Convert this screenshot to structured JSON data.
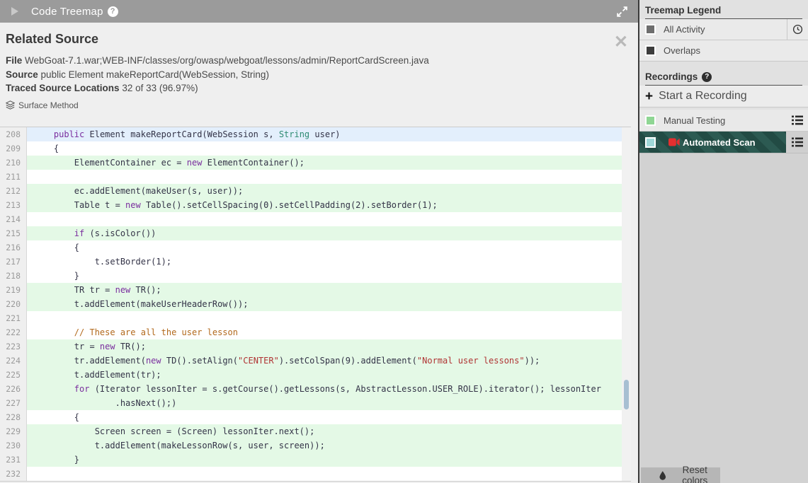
{
  "header": {
    "title": "Code Treemap"
  },
  "related_source": {
    "title": "Related Source",
    "file_label": "File",
    "file_value": "WebGoat-7.1.war;WEB-INF/classes/org/owasp/webgoat/lessons/admin/ReportCardScreen.java",
    "source_label": "Source",
    "source_value": "public Element makeReportCard(WebSession, String)",
    "traced_label": "Traced Source Locations",
    "traced_value": "32 of 33 (96.97%)",
    "method_type": "Surface Method"
  },
  "code": {
    "highlight_green": "#e4f9e6",
    "highlight_blue": "#e3effc",
    "lines": [
      {
        "num": 208,
        "hl": "blue",
        "seg": [
          [
            "p",
            "    "
          ],
          [
            "k",
            "public"
          ],
          [
            "p",
            " Element makeReportCard(WebSession s, "
          ],
          [
            "t",
            "String"
          ],
          [
            "p",
            " user)"
          ]
        ]
      },
      {
        "num": 209,
        "hl": "",
        "seg": [
          [
            "p",
            "    {"
          ]
        ]
      },
      {
        "num": 210,
        "hl": "green",
        "seg": [
          [
            "p",
            "        ElementContainer ec = "
          ],
          [
            "k",
            "new"
          ],
          [
            "p",
            " ElementContainer();"
          ]
        ]
      },
      {
        "num": 211,
        "hl": "",
        "seg": []
      },
      {
        "num": 212,
        "hl": "green",
        "seg": [
          [
            "p",
            "        ec.addElement(makeUser(s, user));"
          ]
        ]
      },
      {
        "num": 213,
        "hl": "green",
        "seg": [
          [
            "p",
            "        Table t = "
          ],
          [
            "k",
            "new"
          ],
          [
            "p",
            " Table().setCellSpacing(0).setCellPadding(2).setBorder(1);"
          ]
        ]
      },
      {
        "num": 214,
        "hl": "",
        "seg": []
      },
      {
        "num": 215,
        "hl": "green",
        "seg": [
          [
            "p",
            "        "
          ],
          [
            "k",
            "if"
          ],
          [
            "p",
            " (s.isColor())"
          ]
        ]
      },
      {
        "num": 216,
        "hl": "",
        "seg": [
          [
            "p",
            "        {"
          ]
        ]
      },
      {
        "num": 217,
        "hl": "",
        "seg": [
          [
            "p",
            "            t.setBorder(1);"
          ]
        ]
      },
      {
        "num": 218,
        "hl": "",
        "seg": [
          [
            "p",
            "        }"
          ]
        ]
      },
      {
        "num": 219,
        "hl": "green",
        "seg": [
          [
            "p",
            "        TR tr = "
          ],
          [
            "k",
            "new"
          ],
          [
            "p",
            " TR();"
          ]
        ]
      },
      {
        "num": 220,
        "hl": "green",
        "seg": [
          [
            "p",
            "        t.addElement(makeUserHeaderRow());"
          ]
        ]
      },
      {
        "num": 221,
        "hl": "",
        "seg": []
      },
      {
        "num": 222,
        "hl": "",
        "seg": [
          [
            "c",
            "        // These are all the user lesson"
          ]
        ]
      },
      {
        "num": 223,
        "hl": "green",
        "seg": [
          [
            "p",
            "        tr = "
          ],
          [
            "k",
            "new"
          ],
          [
            "p",
            " TR();"
          ]
        ]
      },
      {
        "num": 224,
        "hl": "green",
        "seg": [
          [
            "p",
            "        tr.addElement("
          ],
          [
            "k",
            "new"
          ],
          [
            "p",
            " TD().setAlign("
          ],
          [
            "s",
            "\"CENTER\""
          ],
          [
            "p",
            ").setColSpan(9).addElement("
          ],
          [
            "s",
            "\"Normal user lessons\""
          ],
          [
            "p",
            "));"
          ]
        ]
      },
      {
        "num": 225,
        "hl": "green",
        "seg": [
          [
            "p",
            "        t.addElement(tr);"
          ]
        ]
      },
      {
        "num": 226,
        "hl": "green",
        "seg": [
          [
            "p",
            "        "
          ],
          [
            "k",
            "for"
          ],
          [
            "p",
            " (Iterator lessonIter = s.getCourse().getLessons(s, AbstractLesson.USER_ROLE).iterator(); lessonIter"
          ]
        ]
      },
      {
        "num": 227,
        "hl": "green",
        "seg": [
          [
            "p",
            "                .hasNext();)"
          ]
        ]
      },
      {
        "num": 228,
        "hl": "",
        "seg": [
          [
            "p",
            "        {"
          ]
        ]
      },
      {
        "num": 229,
        "hl": "green",
        "seg": [
          [
            "p",
            "            Screen screen = (Screen) lessonIter.next();"
          ]
        ]
      },
      {
        "num": 230,
        "hl": "green",
        "seg": [
          [
            "p",
            "            t.addElement(makeLessonRow(s, user, screen));"
          ]
        ]
      },
      {
        "num": 231,
        "hl": "green",
        "seg": [
          [
            "p",
            "        }"
          ]
        ]
      },
      {
        "num": 232,
        "hl": "",
        "seg": []
      }
    ]
  },
  "sidebar": {
    "legend": {
      "title": "Treemap Legend",
      "items": [
        {
          "label": "All Activity",
          "swatch": "#6e6e6e",
          "time_icon": true
        },
        {
          "label": "Overlaps",
          "swatch": "#3c3c3c",
          "time_icon": false
        }
      ]
    },
    "recordings": {
      "title": "Recordings",
      "start_label": "Start a Recording",
      "items": [
        {
          "label": "Manual Testing",
          "swatch": "#8fd694",
          "active": false
        },
        {
          "label": "Automated Scan",
          "swatch": "#9fd8d8",
          "active": true
        }
      ],
      "active_stripe_colors": [
        "#2c5a52",
        "#224b44"
      ]
    },
    "reset_label": "Reset colors"
  }
}
